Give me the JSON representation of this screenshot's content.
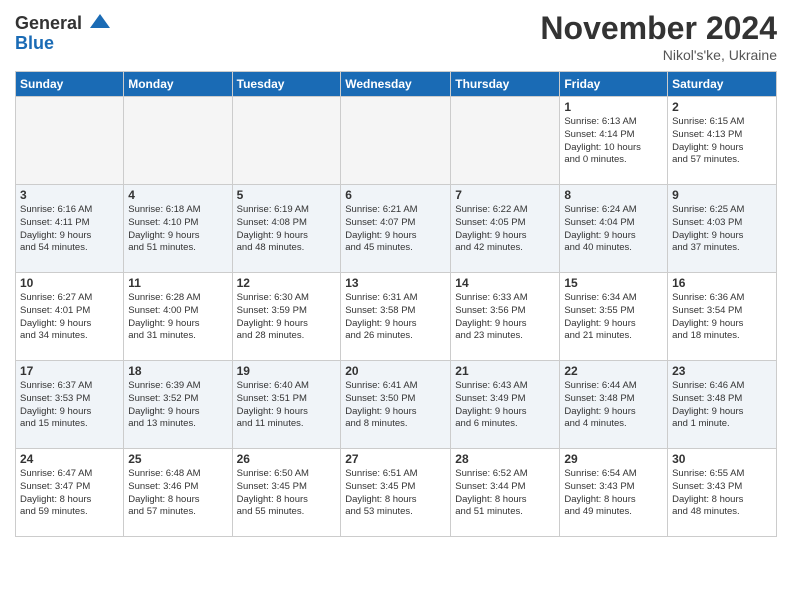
{
  "logo": {
    "general": "General",
    "blue": "Blue"
  },
  "title": "November 2024",
  "location": "Nikol's'ke, Ukraine",
  "weekdays": [
    "Sunday",
    "Monday",
    "Tuesday",
    "Wednesday",
    "Thursday",
    "Friday",
    "Saturday"
  ],
  "weeks": [
    [
      {
        "day": "",
        "info": ""
      },
      {
        "day": "",
        "info": ""
      },
      {
        "day": "",
        "info": ""
      },
      {
        "day": "",
        "info": ""
      },
      {
        "day": "",
        "info": ""
      },
      {
        "day": "1",
        "info": "Sunrise: 6:13 AM\nSunset: 4:14 PM\nDaylight: 10 hours\nand 0 minutes."
      },
      {
        "day": "2",
        "info": "Sunrise: 6:15 AM\nSunset: 4:13 PM\nDaylight: 9 hours\nand 57 minutes."
      }
    ],
    [
      {
        "day": "3",
        "info": "Sunrise: 6:16 AM\nSunset: 4:11 PM\nDaylight: 9 hours\nand 54 minutes."
      },
      {
        "day": "4",
        "info": "Sunrise: 6:18 AM\nSunset: 4:10 PM\nDaylight: 9 hours\nand 51 minutes."
      },
      {
        "day": "5",
        "info": "Sunrise: 6:19 AM\nSunset: 4:08 PM\nDaylight: 9 hours\nand 48 minutes."
      },
      {
        "day": "6",
        "info": "Sunrise: 6:21 AM\nSunset: 4:07 PM\nDaylight: 9 hours\nand 45 minutes."
      },
      {
        "day": "7",
        "info": "Sunrise: 6:22 AM\nSunset: 4:05 PM\nDaylight: 9 hours\nand 42 minutes."
      },
      {
        "day": "8",
        "info": "Sunrise: 6:24 AM\nSunset: 4:04 PM\nDaylight: 9 hours\nand 40 minutes."
      },
      {
        "day": "9",
        "info": "Sunrise: 6:25 AM\nSunset: 4:03 PM\nDaylight: 9 hours\nand 37 minutes."
      }
    ],
    [
      {
        "day": "10",
        "info": "Sunrise: 6:27 AM\nSunset: 4:01 PM\nDaylight: 9 hours\nand 34 minutes."
      },
      {
        "day": "11",
        "info": "Sunrise: 6:28 AM\nSunset: 4:00 PM\nDaylight: 9 hours\nand 31 minutes."
      },
      {
        "day": "12",
        "info": "Sunrise: 6:30 AM\nSunset: 3:59 PM\nDaylight: 9 hours\nand 28 minutes."
      },
      {
        "day": "13",
        "info": "Sunrise: 6:31 AM\nSunset: 3:58 PM\nDaylight: 9 hours\nand 26 minutes."
      },
      {
        "day": "14",
        "info": "Sunrise: 6:33 AM\nSunset: 3:56 PM\nDaylight: 9 hours\nand 23 minutes."
      },
      {
        "day": "15",
        "info": "Sunrise: 6:34 AM\nSunset: 3:55 PM\nDaylight: 9 hours\nand 21 minutes."
      },
      {
        "day": "16",
        "info": "Sunrise: 6:36 AM\nSunset: 3:54 PM\nDaylight: 9 hours\nand 18 minutes."
      }
    ],
    [
      {
        "day": "17",
        "info": "Sunrise: 6:37 AM\nSunset: 3:53 PM\nDaylight: 9 hours\nand 15 minutes."
      },
      {
        "day": "18",
        "info": "Sunrise: 6:39 AM\nSunset: 3:52 PM\nDaylight: 9 hours\nand 13 minutes."
      },
      {
        "day": "19",
        "info": "Sunrise: 6:40 AM\nSunset: 3:51 PM\nDaylight: 9 hours\nand 11 minutes."
      },
      {
        "day": "20",
        "info": "Sunrise: 6:41 AM\nSunset: 3:50 PM\nDaylight: 9 hours\nand 8 minutes."
      },
      {
        "day": "21",
        "info": "Sunrise: 6:43 AM\nSunset: 3:49 PM\nDaylight: 9 hours\nand 6 minutes."
      },
      {
        "day": "22",
        "info": "Sunrise: 6:44 AM\nSunset: 3:48 PM\nDaylight: 9 hours\nand 4 minutes."
      },
      {
        "day": "23",
        "info": "Sunrise: 6:46 AM\nSunset: 3:48 PM\nDaylight: 9 hours\nand 1 minute."
      }
    ],
    [
      {
        "day": "24",
        "info": "Sunrise: 6:47 AM\nSunset: 3:47 PM\nDaylight: 8 hours\nand 59 minutes."
      },
      {
        "day": "25",
        "info": "Sunrise: 6:48 AM\nSunset: 3:46 PM\nDaylight: 8 hours\nand 57 minutes."
      },
      {
        "day": "26",
        "info": "Sunrise: 6:50 AM\nSunset: 3:45 PM\nDaylight: 8 hours\nand 55 minutes."
      },
      {
        "day": "27",
        "info": "Sunrise: 6:51 AM\nSunset: 3:45 PM\nDaylight: 8 hours\nand 53 minutes."
      },
      {
        "day": "28",
        "info": "Sunrise: 6:52 AM\nSunset: 3:44 PM\nDaylight: 8 hours\nand 51 minutes."
      },
      {
        "day": "29",
        "info": "Sunrise: 6:54 AM\nSunset: 3:43 PM\nDaylight: 8 hours\nand 49 minutes."
      },
      {
        "day": "30",
        "info": "Sunrise: 6:55 AM\nSunset: 3:43 PM\nDaylight: 8 hours\nand 48 minutes."
      }
    ]
  ]
}
